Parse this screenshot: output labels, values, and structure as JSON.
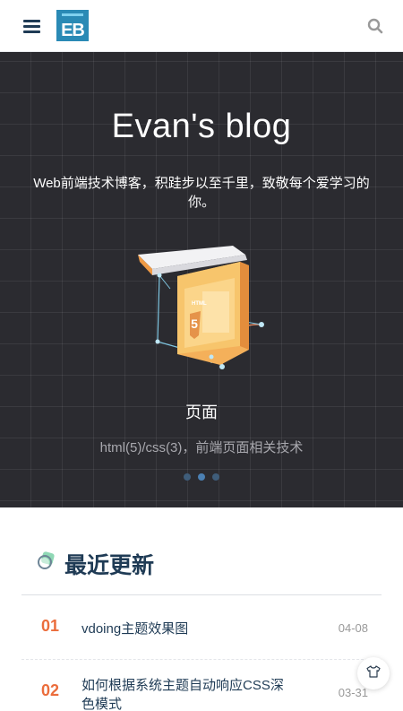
{
  "header": {
    "logo_text": "EB",
    "menu_icon": "hamburger-icon",
    "search_icon": "search-icon"
  },
  "banner": {
    "title": "Evan's blog",
    "description": "Web前端技术博客，积跬步以至千里，致敬每个爱学习的你。",
    "feature_title": "页面",
    "feature_desc": "html(5)/css(3)，前端页面相关技术",
    "feature_image_label": "HTML",
    "slide_count": 3,
    "active_slide": 2
  },
  "recent": {
    "title": "最近更新",
    "posts": [
      {
        "num": "01",
        "title": "vdoing主题效果图",
        "date": "04-08"
      },
      {
        "num": "02",
        "title": "如何根据系统主题自动响应CSS深色模式",
        "date": "03-31"
      }
    ]
  },
  "float_button": {
    "icon": "shirt-icon"
  },
  "colors": {
    "accent": "#eb6d3c",
    "brand": "#2a8ab5",
    "banner_bg": "#2b2b30",
    "heading": "#1f3b55"
  }
}
